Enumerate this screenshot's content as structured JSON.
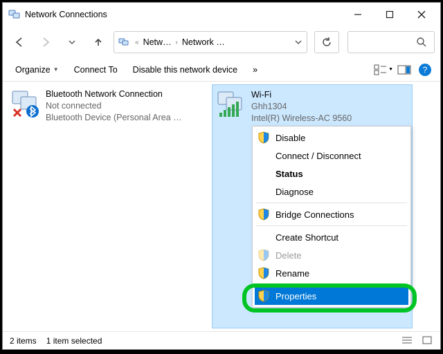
{
  "titlebar": {
    "title": "Network Connections"
  },
  "nav": {
    "crumb1": "Netw…",
    "crumb2": "Network …"
  },
  "toolbar": {
    "organize": "Organize",
    "connect_to": "Connect To",
    "disable": "Disable this network device",
    "more_glyph": "»"
  },
  "adapters": [
    {
      "name": "Bluetooth Network Connection",
      "status": "Not connected",
      "device": "Bluetooth Device (Personal Area …"
    },
    {
      "name": "Wi-Fi",
      "status": "Ghh1304",
      "device": "Intel(R) Wireless-AC 9560"
    }
  ],
  "context_menu": {
    "disable": "Disable",
    "connect_disconnect": "Connect / Disconnect",
    "status": "Status",
    "diagnose": "Diagnose",
    "bridge": "Bridge Connections",
    "create_shortcut": "Create Shortcut",
    "delete": "Delete",
    "rename": "Rename",
    "properties": "Properties"
  },
  "statusbar": {
    "count": "2 items",
    "selected": "1 item selected"
  }
}
